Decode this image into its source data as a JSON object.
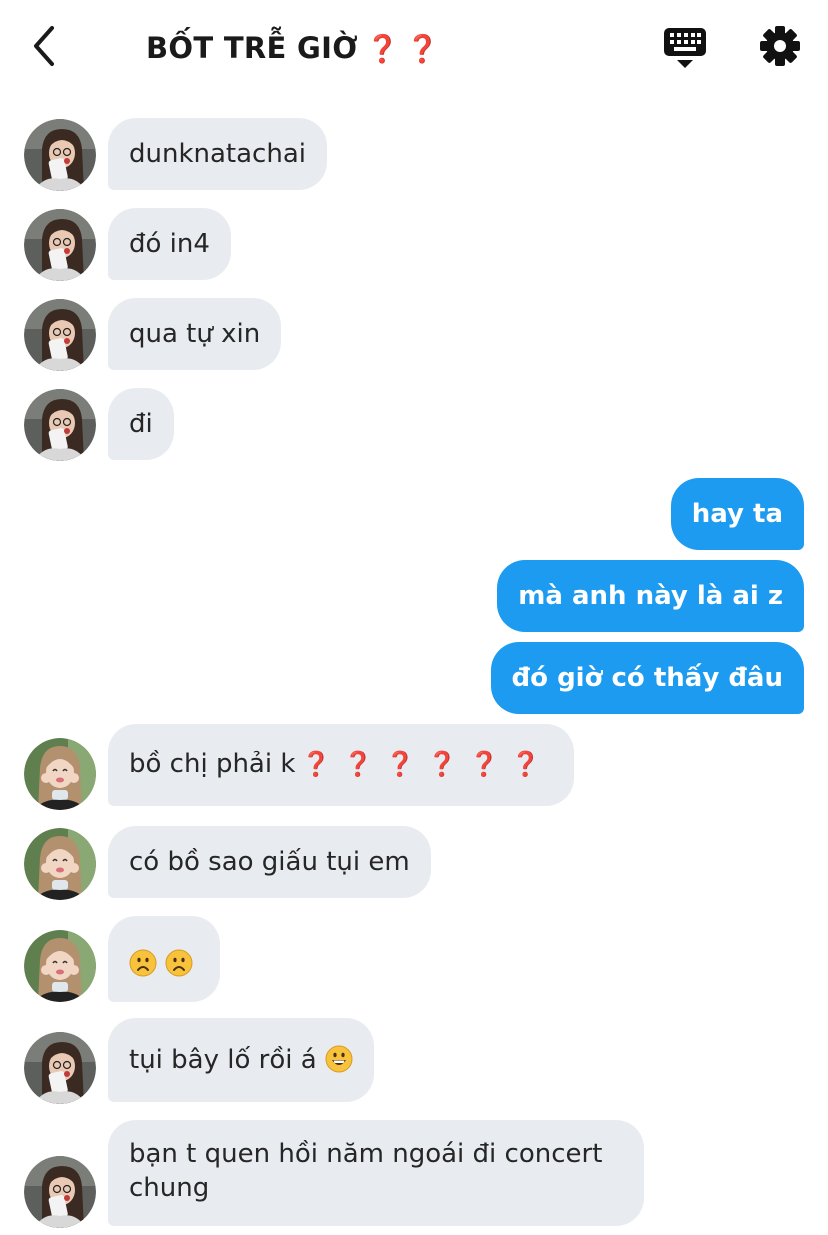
{
  "header": {
    "title": "BỐT TRỄ GIỜ",
    "title_marks": "❓❓"
  },
  "colors": {
    "outgoing_bubble": "#1d9bf0",
    "incoming_bubble": "#e8ebef",
    "question_mark": "#e0243a"
  },
  "messages": [
    {
      "text": "dunknatachai",
      "sender": "avatar-a"
    },
    {
      "text": "đó in4",
      "sender": "avatar-a"
    },
    {
      "text": "qua tự xin",
      "sender": "avatar-a"
    },
    {
      "text": "đi",
      "sender": "avatar-a"
    },
    {
      "text": "hay ta",
      "sender": "me"
    },
    {
      "text": "mà anh này là ai z",
      "sender": "me"
    },
    {
      "text": "đó giờ có thấy đâu",
      "sender": "me"
    },
    {
      "text": "bồ chị phải k",
      "marks": "❓❓❓❓❓❓",
      "sender": "avatar-b"
    },
    {
      "text": "có bồ sao giấu tụi em",
      "sender": "avatar-b"
    },
    {
      "emoji": "frowning-face-emoji ×2",
      "sender": "avatar-b"
    },
    {
      "text": "tụi bây lố rồi á",
      "emoji": "grinning-face-emoji",
      "sender": "avatar-a"
    },
    {
      "text": "bạn t quen hồi năm ngoái đi concert chung",
      "sender": "avatar-a"
    }
  ]
}
